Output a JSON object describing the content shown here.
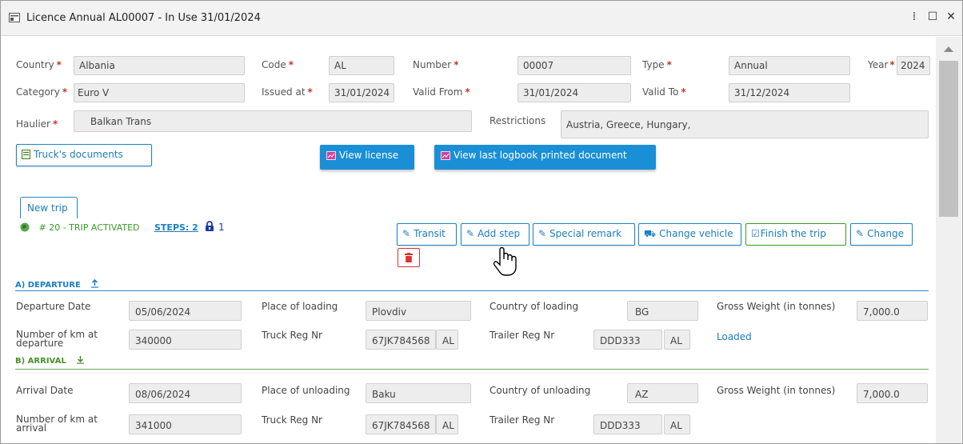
{
  "window": {
    "title": "Licence Annual AL00007 - In Use 31/01/2024",
    "controls": {
      "pin": "⁞",
      "maximize": "☐",
      "close": "✕"
    }
  },
  "licence": {
    "country_label": "Country",
    "country": "Albania",
    "code_label": "Code",
    "code": "AL",
    "number_label": "Number",
    "number": "00007",
    "type_label": "Type",
    "type": "Annual",
    "year_label": "Year",
    "year": "2024",
    "category_label": "Category",
    "category": "Euro V",
    "issued_label": "Issued at",
    "issued": "31/01/2024",
    "valid_from_label": "Valid From",
    "valid_from": "31/01/2024",
    "valid_to_label": "Valid To",
    "valid_to": "31/12/2024",
    "haulier_label": "Haulier",
    "haulier": "Balkan Trans",
    "restrictions_label": "Restrictions",
    "restrictions": "Austria,  Greece,  Hungary,",
    "required_mark": "*"
  },
  "buttons": {
    "trucks_documents": "Truck's documents",
    "view_license": "View license",
    "view_logbook": "View last logbook printed document"
  },
  "trip": {
    "tab_label": "New trip",
    "status": "# 20 - TRIP ACTIVATED",
    "steps_link": "STEPS: 2",
    "lock_count": "1",
    "actions": {
      "transit": "Transit",
      "add_step": "Add step",
      "special_remark": "Special remark",
      "change_vehicle": "Change vehicle",
      "finish_trip": "Finish the trip",
      "change": "Change"
    }
  },
  "departure": {
    "section_label": "A) DEPARTURE",
    "date_label": "Departure Date",
    "date": "05/06/2024",
    "place_label": "Place of loading",
    "place": "Plovdiv",
    "country_label": "Country of loading",
    "country": "BG",
    "weight_label": "Gross Weight (in tonnes)",
    "weight": "7,000.0",
    "km_label_1": "Number of km at",
    "km_label_2": "departure",
    "km": "340000",
    "truck_label": "Truck Reg Nr",
    "truck": "67JK784568",
    "truck_country": "AL",
    "trailer_label": "Trailer Reg Nr",
    "trailer": "DDD333",
    "trailer_country": "AL",
    "load_status": "Loaded"
  },
  "arrival": {
    "section_label": "B) ARRIVAL",
    "date_label": "Arrival Date",
    "date": "08/06/2024",
    "place_label": "Place of unloading",
    "place": "Baku",
    "country_label": "Country of unloading",
    "country": "AZ",
    "weight_label": "Gross Weight (in tonnes)",
    "weight": "7,000.0",
    "km_label_1": "Number of km at",
    "km_label_2": "arrival",
    "km": "341000",
    "truck_label": "Truck Reg Nr",
    "truck": "67JK784568",
    "truck_country": "AL",
    "trailer_label": "Trailer Reg Nr",
    "trailer": "DDD333",
    "trailer_country": "AL"
  },
  "colors": {
    "accent_blue": "#1a8fd6",
    "required_red": "#c0392b",
    "status_green": "#3a9a2a",
    "delete_red": "#e03030"
  }
}
